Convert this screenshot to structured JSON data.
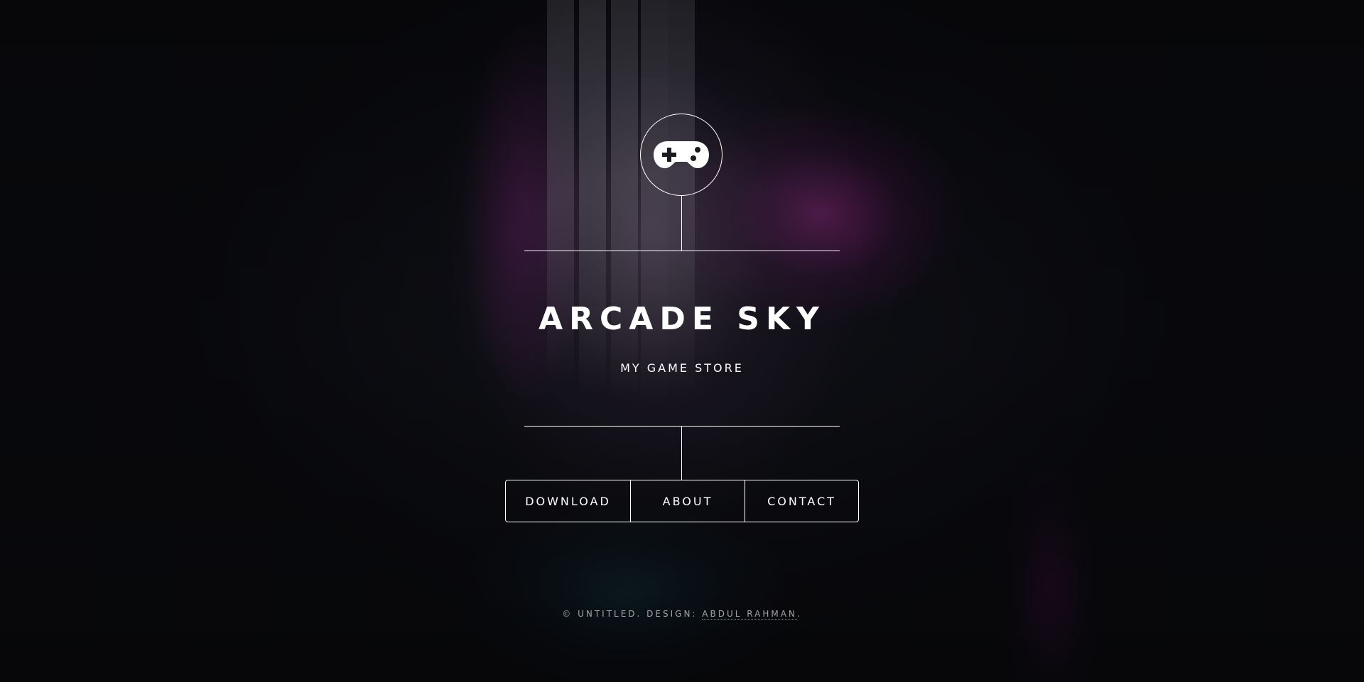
{
  "site": {
    "logo_icon": "gamepad-icon",
    "title": "ARCADE SKY",
    "subtitle": "MY GAME STORE"
  },
  "nav": {
    "items": [
      {
        "label": "DOWNLOAD"
      },
      {
        "label": "ABOUT"
      },
      {
        "label": "CONTACT"
      }
    ]
  },
  "footer": {
    "prefix": "© UNTITLED. DESIGN: ",
    "author_link": "ABDUL RAHMAN",
    "suffix": "."
  },
  "colors": {
    "text": "#ffffff",
    "background": "#0b0c10",
    "accent_magenta": "#b0289a",
    "accent_teal": "#14505f"
  }
}
